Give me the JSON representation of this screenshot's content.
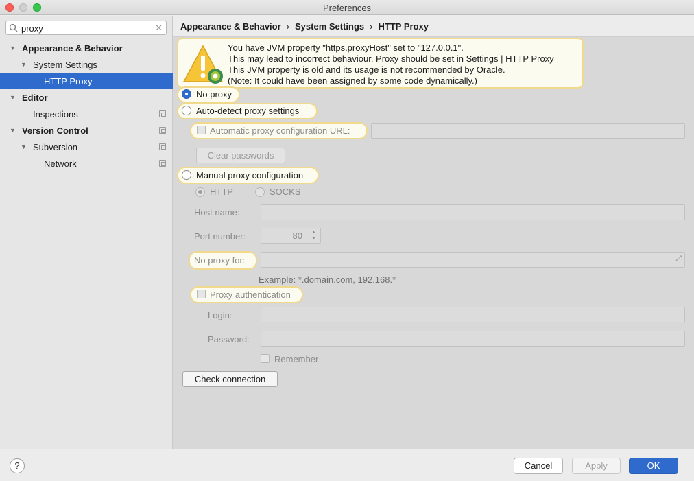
{
  "window": {
    "title": "Preferences"
  },
  "search": {
    "value": "proxy"
  },
  "sidebar": {
    "items": [
      {
        "label": "Appearance & Behavior"
      },
      {
        "label": "System Settings"
      },
      {
        "label": "HTTP Proxy"
      },
      {
        "label": "Editor"
      },
      {
        "label": "Inspections"
      },
      {
        "label": "Version Control"
      },
      {
        "label": "Subversion"
      },
      {
        "label": "Network"
      }
    ]
  },
  "breadcrumb": [
    "Appearance & Behavior",
    "System Settings",
    "HTTP Proxy"
  ],
  "warning": {
    "lines": [
      "You have JVM property \"https.proxyHost\" set to \"127.0.0.1\".",
      "This may lead to incorrect behaviour. Proxy should be set in Settings | HTTP Proxy",
      "This JVM property is old and its usage is not recommended by Oracle.",
      "(Note: It could have been assigned by some code dynamically.)"
    ]
  },
  "proxy": {
    "no_proxy": "No proxy",
    "auto_detect": "Auto-detect proxy settings",
    "auto_config_url": "Automatic proxy configuration URL:",
    "clear_passwords": "Clear passwords",
    "manual": "Manual proxy configuration",
    "http": "HTTP",
    "socks": "SOCKS",
    "host_name": "Host name:",
    "port_number": "Port number:",
    "port_value": "80",
    "no_proxy_for": "No proxy for:",
    "example": "Example: *.domain.com, 192.168.*",
    "proxy_auth": "Proxy authentication",
    "login": "Login:",
    "password": "Password:",
    "remember": "Remember",
    "check_connection": "Check connection"
  },
  "buttons": {
    "cancel": "Cancel",
    "apply": "Apply",
    "ok": "OK",
    "help": "?"
  }
}
